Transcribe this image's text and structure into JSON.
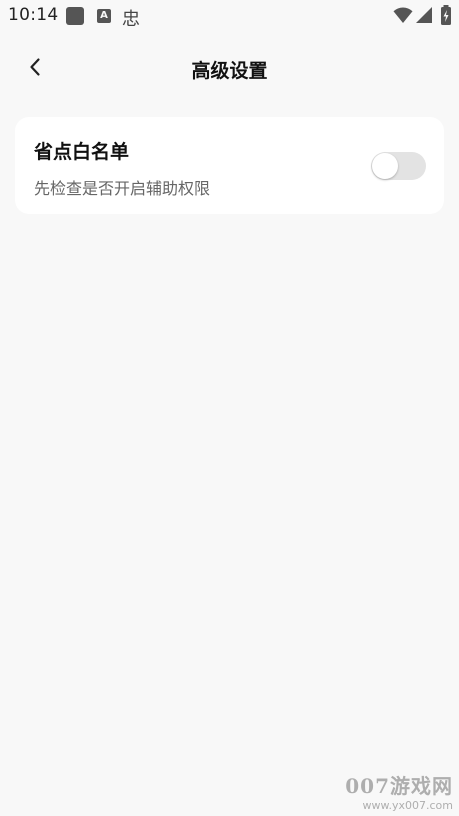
{
  "status_bar": {
    "time": "10:14",
    "notification_icons": [
      "app-notification-icon",
      "text-notification-icon",
      "bug-notification-icon"
    ],
    "notif_a_glyph": "A",
    "notif_bug_glyph": "忠",
    "system_icons": [
      "wifi-icon",
      "signal-icon",
      "battery-icon"
    ]
  },
  "header": {
    "back_icon": "chevron-left-icon",
    "title": "高级设置"
  },
  "settings": {
    "items": [
      {
        "title": "省点白名单",
        "subtitle": "先检查是否开启辅助权限",
        "toggle_on": false
      }
    ]
  },
  "watermark": {
    "main": "007游戏网",
    "url": "www.yx007.com"
  },
  "colors": {
    "background": "#f8f8f8",
    "card": "#ffffff",
    "toggle_track_off": "#e3e3e3",
    "subtitle_text": "#666666"
  }
}
